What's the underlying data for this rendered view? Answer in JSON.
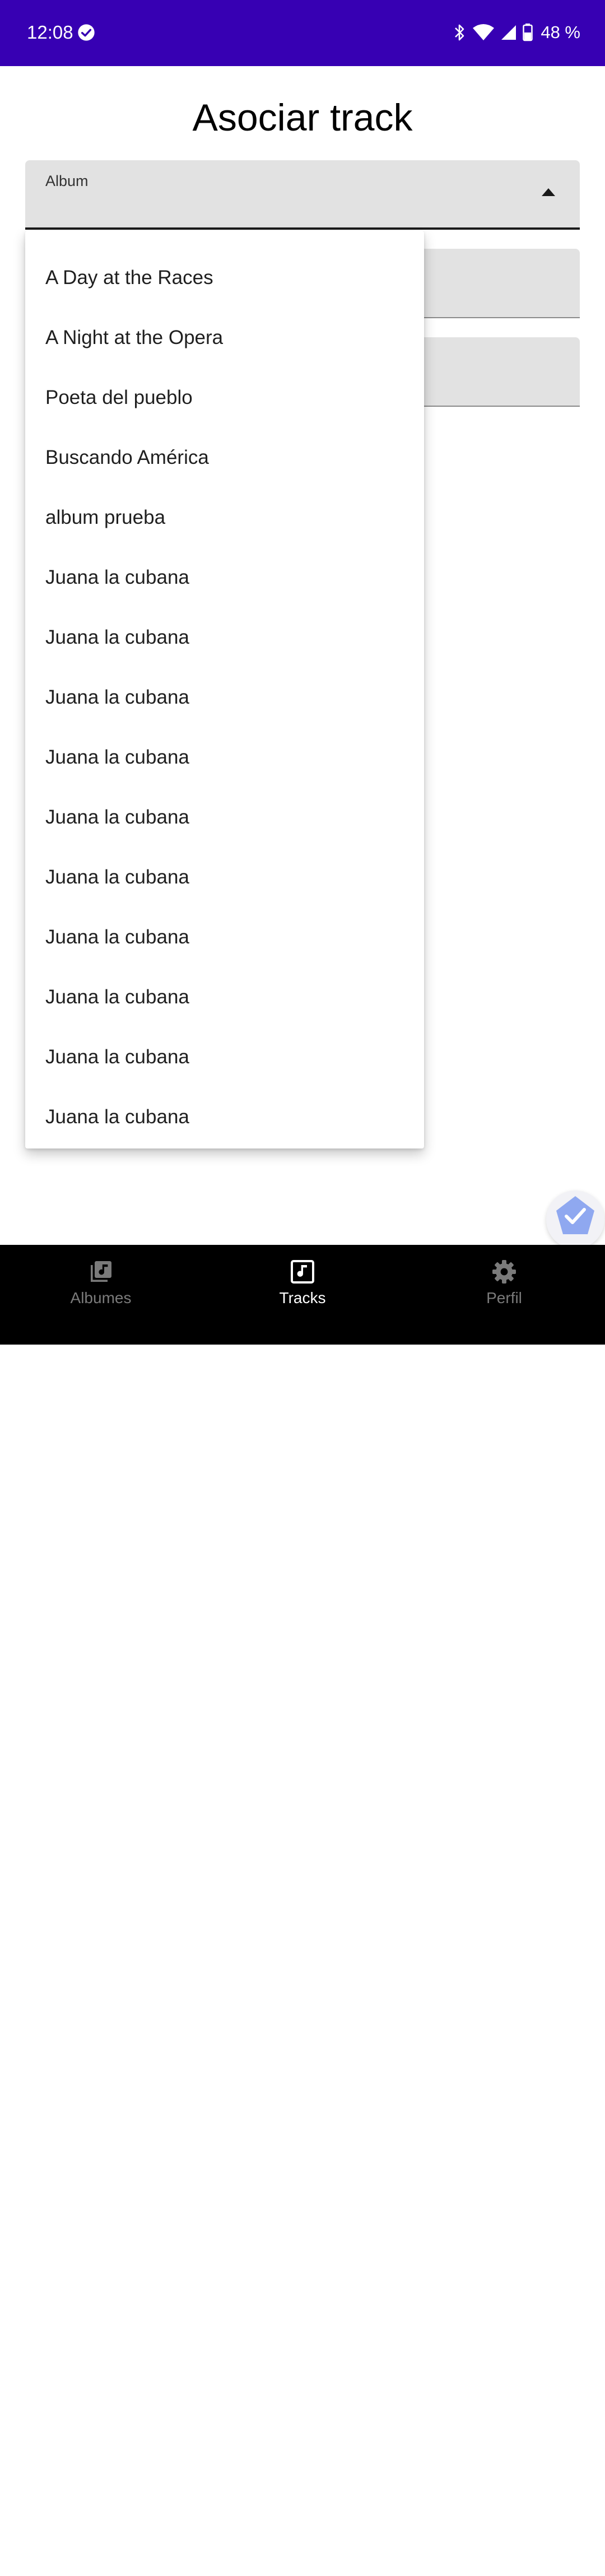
{
  "status_bar": {
    "time": "12:08",
    "battery": "48 %",
    "icons": [
      "check-circle-icon",
      "bluetooth-icon",
      "wifi-icon",
      "signal-icon",
      "battery-icon"
    ],
    "background_color": "#3700b3"
  },
  "page": {
    "title": "Asociar track"
  },
  "album_field": {
    "label": "Album",
    "value": "",
    "expanded": true
  },
  "dropdown": {
    "options": [
      "A Day at the Races",
      "A Night at the Opera",
      "Poeta del pueblo",
      "Buscando América",
      "album prueba",
      "Juana la cubana",
      "Juana la cubana",
      "Juana la cubana",
      "Juana la cubana",
      "Juana la cubana",
      "Juana la cubana",
      "Juana la cubana",
      "Juana la cubana",
      "Juana la cubana",
      "Juana la cubana"
    ]
  },
  "fab": {
    "icon": "check-icon",
    "color": "#8fa8f0"
  },
  "bottom_nav": {
    "items": [
      {
        "label": "Albumes",
        "icon": "album-library-icon",
        "active": false
      },
      {
        "label": "Tracks",
        "icon": "music-note-icon",
        "active": true
      },
      {
        "label": "Perfil",
        "icon": "gear-icon",
        "active": false
      }
    ]
  }
}
